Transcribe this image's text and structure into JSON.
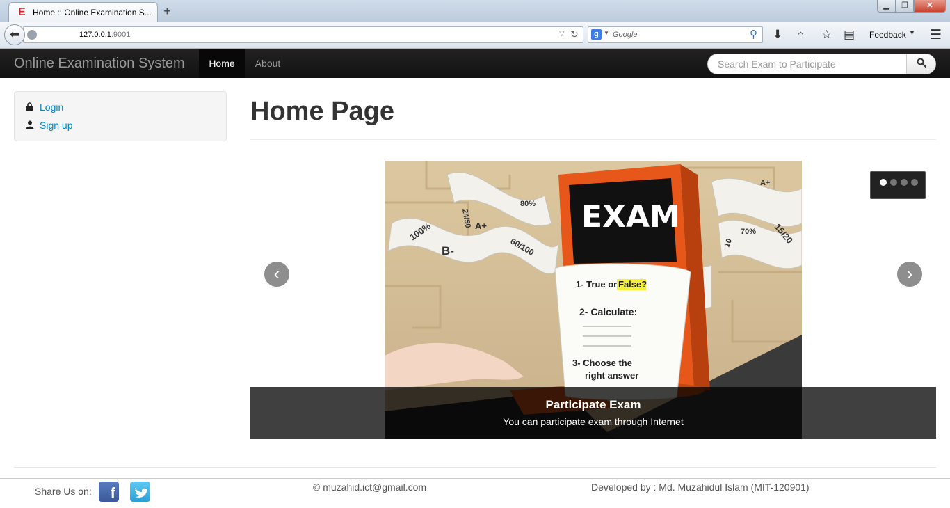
{
  "browser": {
    "tab_title": "Home :: Online Examination S...",
    "new_tab": "+",
    "url_host": "127.0.0.1",
    "url_port": ":9001",
    "search_placeholder": "Google",
    "search_engine_letter": "g",
    "feedback_label": "Feedback",
    "window_buttons": {
      "minimize": "▁",
      "maximize": "❐",
      "close": "✕"
    }
  },
  "site_nav": {
    "brand": "Online Examination System",
    "items": [
      {
        "label": "Home",
        "active": true
      },
      {
        "label": "About",
        "active": false
      }
    ],
    "search_placeholder": "Search Exam to Participate"
  },
  "sidebar": {
    "items": [
      {
        "label": "Login",
        "icon": "lock-icon"
      },
      {
        "label": "Sign up",
        "icon": "user-icon"
      }
    ]
  },
  "main": {
    "title": "Home Page",
    "carousel": {
      "slide_count": 4,
      "active_index": 0,
      "image_text": {
        "screen": "EXAM",
        "q1": "1- True or",
        "q1_answer": "False?",
        "q2": "2- Calculate:",
        "q3_line1": "3- Choose the",
        "q3_line2": "right answer",
        "ribbons": [
          "100%",
          "B-",
          "A+",
          "60/100",
          "80%",
          "24/50",
          "A+",
          "15/20",
          "70%",
          "10"
        ]
      },
      "caption_title": "Participate Exam",
      "caption_text": "You can participate exam through Internet",
      "prev": "‹",
      "next": "›"
    }
  },
  "footer": {
    "share_label": "Share Us on:",
    "facebook_letter": "f",
    "copyright": "© muzahid.ict@gmail.com",
    "developer": "Developed by : Md. Muzahidul Islam (MIT-120901)"
  },
  "colors": {
    "nav_bg": "#1b1b1b",
    "link": "#0088cc",
    "exam_orange": "#f26522"
  }
}
